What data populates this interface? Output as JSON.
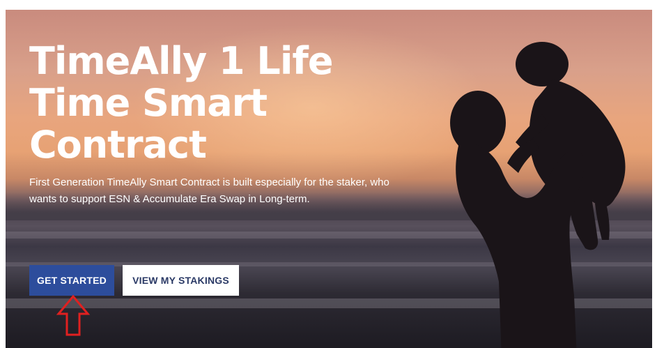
{
  "hero": {
    "title_line1": "TimeAlly 1 Life",
    "title_line2": "Time Smart",
    "title_line3": "Contract",
    "description": "First Generation TimeAlly Smart Contract is built especially for the staker, who wants to support ESN & Accumulate Era Swap in Long-term."
  },
  "buttons": {
    "get_started": "GET STARTED",
    "view_stakings": "VIEW MY STAKINGS"
  },
  "colors": {
    "primary_button": "#2d4d9c",
    "annotation_arrow": "#e02020"
  },
  "icons": {
    "hero_image": "parent-lifting-child-silhouette",
    "annotation": "up-arrow-icon"
  }
}
